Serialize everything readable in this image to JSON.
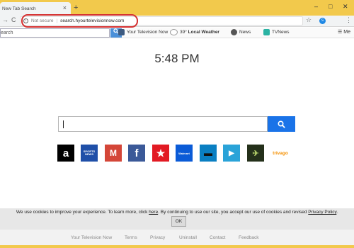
{
  "browser": {
    "tab_title": "New Tab Search",
    "tab_close": "×",
    "new_tab": "+",
    "win_min": "–",
    "win_max": "□",
    "win_close": "✕",
    "nav_forward": "→",
    "nav_reload": "C",
    "not_secure": "Not secure",
    "url": "search.hyourtelevisionnow.com",
    "star": "☆",
    "ext_label": "s",
    "menu": "⋮",
    "highlight_color": "#d42f2f"
  },
  "toolbar": {
    "search_placeholder": "earch",
    "search_button": "Q",
    "items": [
      {
        "label": "Your Television Now",
        "icon": "tv-icon"
      },
      {
        "label": "39°",
        "icon": "weather-icon"
      },
      {
        "label": "Local Weather",
        "icon": "weather-icon"
      },
      {
        "label": "News",
        "icon": "news-icon"
      },
      {
        "label": "TVNews",
        "icon": "tv-news-icon"
      }
    ],
    "menu_label": "Me"
  },
  "main": {
    "time": "5:48 PM",
    "search_button_icon": "search-icon",
    "tiles": [
      {
        "name": "amazon",
        "glyph": "a",
        "color": "#000000"
      },
      {
        "name": "sports-news",
        "glyph": "SPORTS NEWS",
        "color": "#1f4fa8"
      },
      {
        "name": "gmail",
        "glyph": "M",
        "color": "#d44638"
      },
      {
        "name": "facebook",
        "glyph": "f",
        "color": "#3b5998"
      },
      {
        "name": "macys",
        "glyph": "★",
        "color": "#e21a23"
      },
      {
        "name": "walmart",
        "glyph": "Walmart",
        "color": "#0a5bd7"
      },
      {
        "name": "tv",
        "glyph": "▬",
        "color": "#0a7fc2"
      },
      {
        "name": "video",
        "glyph": "▶",
        "color": "#2aa3d8"
      },
      {
        "name": "travel",
        "glyph": "✈",
        "color": "#24301a"
      },
      {
        "name": "trivago",
        "glyph": "trivago",
        "color": "#f48f00"
      }
    ]
  },
  "cookie": {
    "text_before": "We use cookies to improve your experience. To learn more, click ",
    "here": "here",
    "text_after": ". By continuing to use our site, you accept our use of cookies and revised ",
    "policy": "Privacy Policy",
    "text_end": ".",
    "ok": "OK"
  },
  "footer": {
    "links": [
      "Your Television Now",
      "Terms",
      "Privacy",
      "Uninstall",
      "Contact",
      "Feedback"
    ]
  }
}
